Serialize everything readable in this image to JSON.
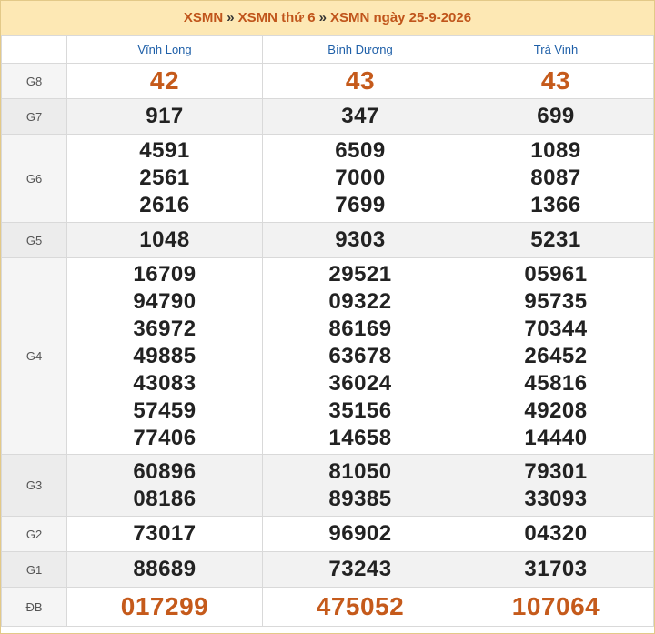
{
  "breadcrumb": {
    "item1": "XSMN",
    "item2": "XSMN thứ 6",
    "item3": "XSMN ngày 25-9-2026",
    "separator": "»"
  },
  "provinces": [
    "Vĩnh Long",
    "Bình Dương",
    "Trà Vinh"
  ],
  "accent_color": "#c55a1b",
  "header_bg": "#fde8b4",
  "prizes": [
    {
      "label": "G8",
      "results": [
        [
          "42"
        ],
        [
          "43"
        ],
        [
          "43"
        ]
      ]
    },
    {
      "label": "G7",
      "results": [
        [
          "917"
        ],
        [
          "347"
        ],
        [
          "699"
        ]
      ]
    },
    {
      "label": "G6",
      "results": [
        [
          "4591",
          "2561",
          "2616"
        ],
        [
          "6509",
          "7000",
          "7699"
        ],
        [
          "1089",
          "8087",
          "1366"
        ]
      ]
    },
    {
      "label": "G5",
      "results": [
        [
          "1048"
        ],
        [
          "9303"
        ],
        [
          "5231"
        ]
      ]
    },
    {
      "label": "G4",
      "results": [
        [
          "16709",
          "94790",
          "36972",
          "49885",
          "43083",
          "57459",
          "77406"
        ],
        [
          "29521",
          "09322",
          "86169",
          "63678",
          "36024",
          "35156",
          "14658"
        ],
        [
          "05961",
          "95735",
          "70344",
          "26452",
          "45816",
          "49208",
          "14440"
        ]
      ]
    },
    {
      "label": "G3",
      "results": [
        [
          "60896",
          "08186"
        ],
        [
          "81050",
          "89385"
        ],
        [
          "79301",
          "33093"
        ]
      ]
    },
    {
      "label": "G2",
      "results": [
        [
          "73017"
        ],
        [
          "96902"
        ],
        [
          "04320"
        ]
      ]
    },
    {
      "label": "G1",
      "results": [
        [
          "88689"
        ],
        [
          "73243"
        ],
        [
          "31703"
        ]
      ]
    },
    {
      "label": "ĐB",
      "results": [
        [
          "017299"
        ],
        [
          "475052"
        ],
        [
          "107064"
        ]
      ]
    }
  ]
}
